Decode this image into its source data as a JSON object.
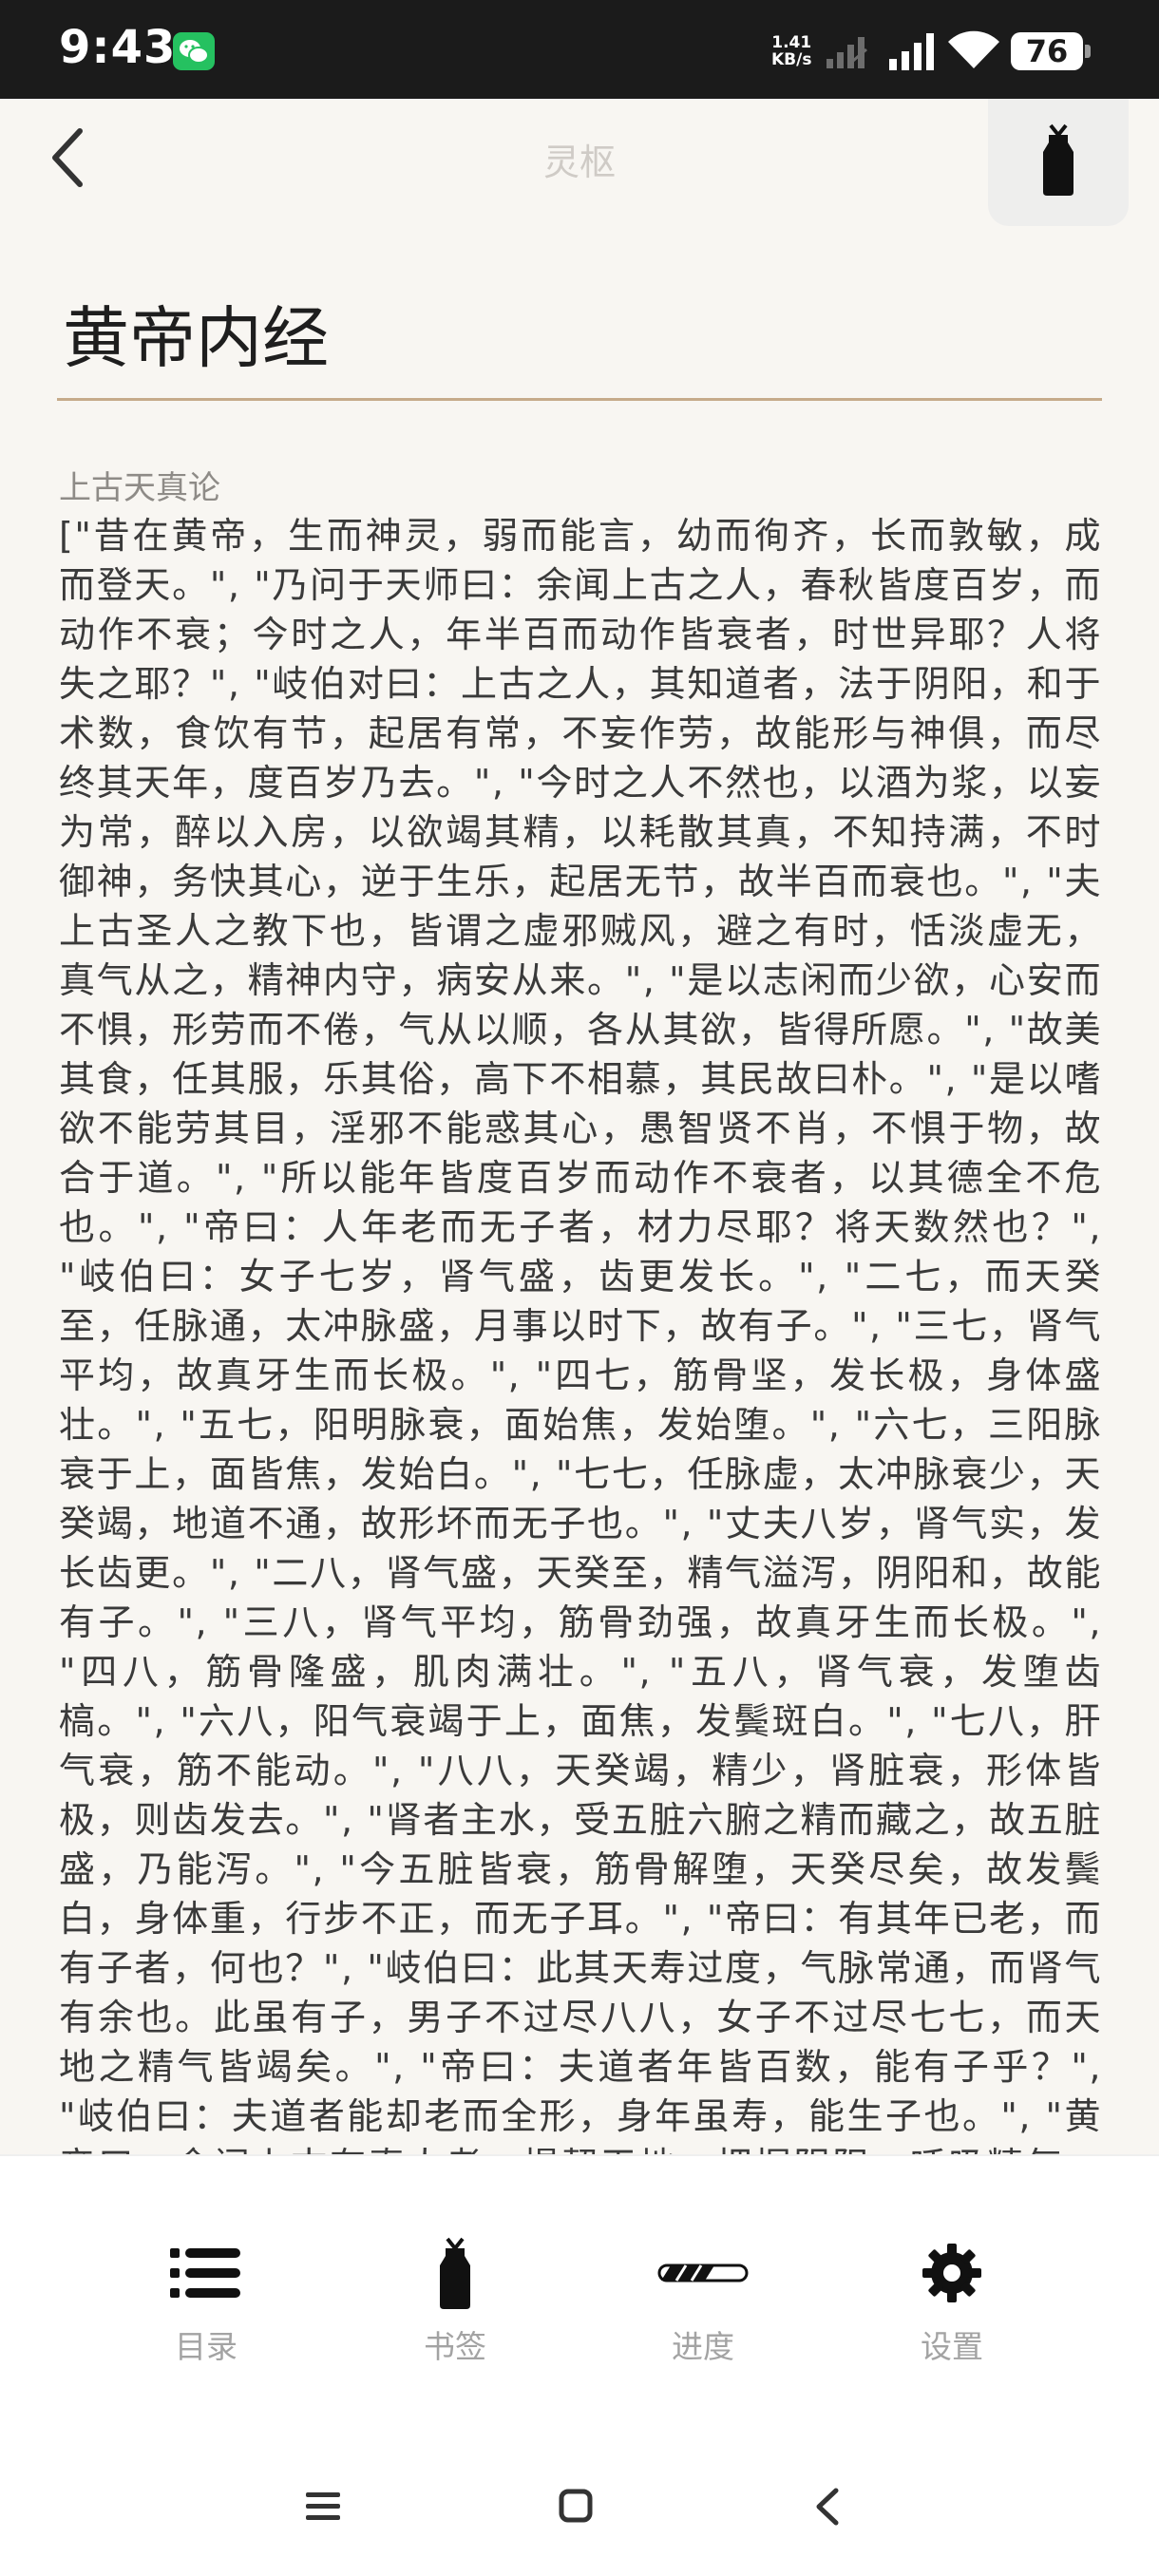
{
  "status_bar": {
    "time": "9:43",
    "net_speed_value": "1.41",
    "net_speed_unit": "KB/s",
    "battery": "76"
  },
  "header": {
    "title": "灵枢"
  },
  "book": {
    "title": "黄帝内经",
    "chapter": "上古天真论",
    "content": "[\"昔在黄帝，生而神灵，弱而能言，幼而徇齐，长而敦敏，成而登天。\", \"乃问于天师曰：余闻上古之人，春秋皆度百岁，而动作不衰；今时之人，年半百而动作皆衰者，时世异耶？人将失之耶？\", \"岐伯对曰：上古之人，其知道者，法于阴阳，和于术数，食饮有节，起居有常，不妄作劳，故能形与神俱，而尽终其天年，度百岁乃去。\", \"今时之人不然也，以酒为浆，以妄为常，醉以入房，以欲竭其精，以耗散其真，不知持满，不时御神，务快其心，逆于生乐，起居无节，故半百而衰也。\", \"夫上古圣人之教下也，皆谓之虚邪贼风，避之有时，恬淡虚无，真气从之，精神内守，病安从来。\", \"是以志闲而少欲，心安而不惧，形劳而不倦，气从以顺，各从其欲，皆得所愿。\", \"故美其食，任其服，乐其俗，高下不相慕，其民故曰朴。\", \"是以嗜欲不能劳其目，淫邪不能惑其心，愚智贤不肖，不惧于物，故合于道。\", \"所以能年皆度百岁而动作不衰者，以其德全不危也。\", \"帝曰：人年老而无子者，材力尽耶？将天数然也？\", \"岐伯曰：女子七岁，肾气盛，齿更发长。\", \"二七，而天癸至，任脉通，太冲脉盛，月事以时下，故有子。\", \"三七，肾气平均，故真牙生而长极。\", \"四七，筋骨坚，发长极，身体盛壮。\", \"五七，阳明脉衰，面始焦，发始堕。\", \"六七，三阳脉衰于上，面皆焦，发始白。\", \"七七，任脉虚，太冲脉衰少，天癸竭，地道不通，故形坏而无子也。\", \"丈夫八岁，肾气实，发长齿更。\", \"二八，肾气盛，天癸至，精气溢泻，阴阳和，故能有子。\", \"三八，肾气平均，筋骨劲强，故真牙生而长极。\", \"四八，筋骨隆盛，肌肉满壮。\", \"五八，肾气衰，发堕齿槁。\", \"六八，阳气衰竭于上，面焦，发鬓斑白。\", \"七八，肝气衰，筋不能动。\", \"八八，天癸竭，精少，肾脏衰，形体皆极，则齿发去。\", \"肾者主水，受五脏六腑之精而藏之，故五脏盛，乃能泻。\", \"今五脏皆衰，筋骨解堕，天癸尽矣，故发鬓白，身体重，行步不正，而无子耳。\", \"帝曰：有其年已老，而有子者，何也？\", \"岐伯曰：此其天寿过度，气脉常通，而肾气有余也。此虽有子，男子不过尽八八，女子不过尽七七，而天地之精气皆竭矣。\", \"帝曰：夫道者年皆百数，能有子乎？\", \"岐伯曰：夫道者能却老而全形，身年虽寿，能生子也。\", \"黄帝曰：余闻上古有真人者，提挈天地，把握阴阳，呼吸精气，独立守神，肌肉若一，故能寿敝天地，无有终时，此其道生。\","
  },
  "toolbar": {
    "items": [
      {
        "label": "目录",
        "icon": "list-icon"
      },
      {
        "label": "书签",
        "icon": "bookmark-icon"
      },
      {
        "label": "进度",
        "icon": "progress-icon"
      },
      {
        "label": "设置",
        "icon": "gear-icon"
      }
    ]
  },
  "colors": {
    "status_bar_bg": "#1b1b1b",
    "page_bg": "#f8f6f2",
    "title_rule": "#c6ab8a",
    "icon_dark": "#111111",
    "label_gray": "#a3a3a3"
  }
}
